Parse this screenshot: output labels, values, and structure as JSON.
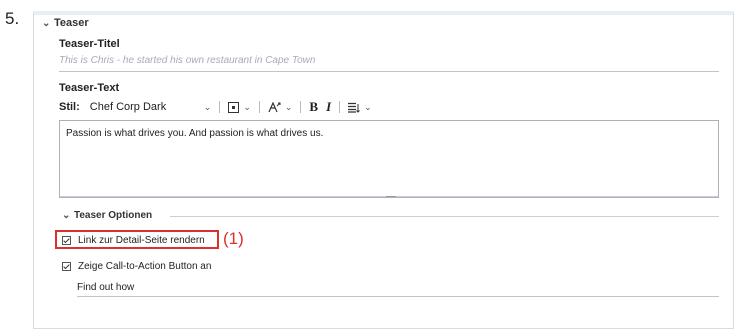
{
  "step_number": "5.",
  "section": {
    "title": "Teaser"
  },
  "teaser_title": {
    "label": "Teaser-Titel",
    "placeholder": "This is Chris - he started his own restaurant in Cape Town"
  },
  "teaser_text": {
    "label": "Teaser-Text",
    "style_label": "Stil:",
    "style_value": "Chef Corp Dark",
    "bold_glyph": "B",
    "italic_glyph": "I",
    "content": "Passion is what drives you. And passion is what drives us."
  },
  "options": {
    "header": "Teaser Optionen",
    "checkboxes": [
      {
        "label": "Link zur Detail-Seite rendern",
        "checked": true
      },
      {
        "label": "Zeige Call-to-Action Button an",
        "checked": true
      }
    ],
    "cta_text": "Find out how"
  },
  "annotation": {
    "label": "(1)",
    "color": "#d9312b"
  }
}
